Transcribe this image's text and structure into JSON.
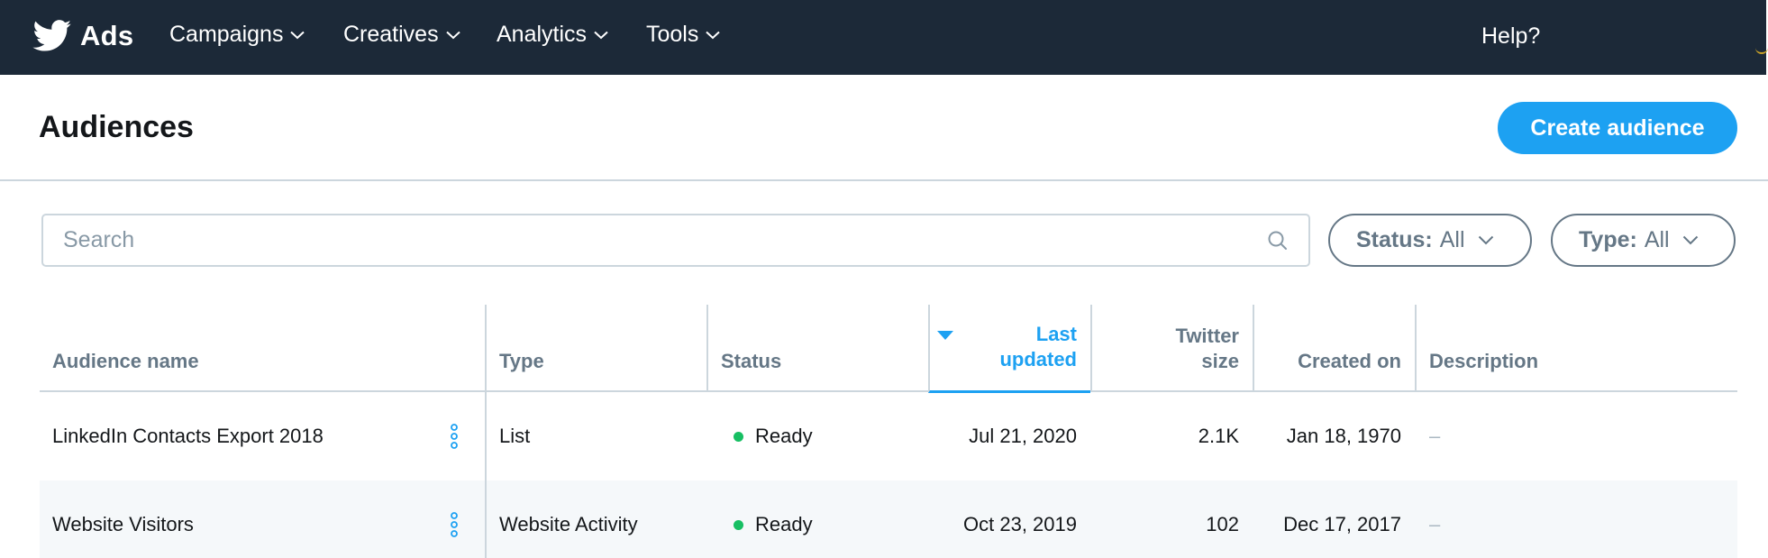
{
  "topnav": {
    "brand": "Ads",
    "menu": [
      {
        "label": "Campaigns"
      },
      {
        "label": "Creatives"
      },
      {
        "label": "Analytics"
      },
      {
        "label": "Tools"
      }
    ],
    "help": "Help?"
  },
  "page": {
    "title": "Audiences",
    "create_button": "Create audience"
  },
  "search": {
    "placeholder": "Search",
    "value": ""
  },
  "filters": {
    "status": {
      "key": "Status:",
      "value": "All"
    },
    "type": {
      "key": "Type:",
      "value": "All"
    }
  },
  "table": {
    "columns": {
      "name": "Audience name",
      "type": "Type",
      "status": "Status",
      "last_updated_1": "Last",
      "last_updated_2": "updated",
      "twitter_size_1": "Twitter",
      "twitter_size_2": "size",
      "created_on": "Created on",
      "description": "Description"
    },
    "sort": {
      "column": "Last updated",
      "direction": "descending"
    },
    "rows": [
      {
        "name": "LinkedIn Contacts Export 2018",
        "type": "List",
        "status": "Ready",
        "last_updated": "Jul 21, 2020",
        "twitter_size": "2.1K",
        "created_on": "Jan 18, 1970",
        "description": "–"
      },
      {
        "name": "Website Visitors",
        "type": "Website Activity",
        "status": "Ready",
        "last_updated": "Oct 23, 2019",
        "twitter_size": "102",
        "created_on": "Dec 17, 2017",
        "description": "–"
      }
    ]
  },
  "colors": {
    "nav_bg": "#1c2938",
    "accent": "#1da1f2",
    "status_ready": "#17bf63",
    "muted": "#657786",
    "border": "#ccd6dd",
    "row_alt": "#f5f8fa"
  }
}
